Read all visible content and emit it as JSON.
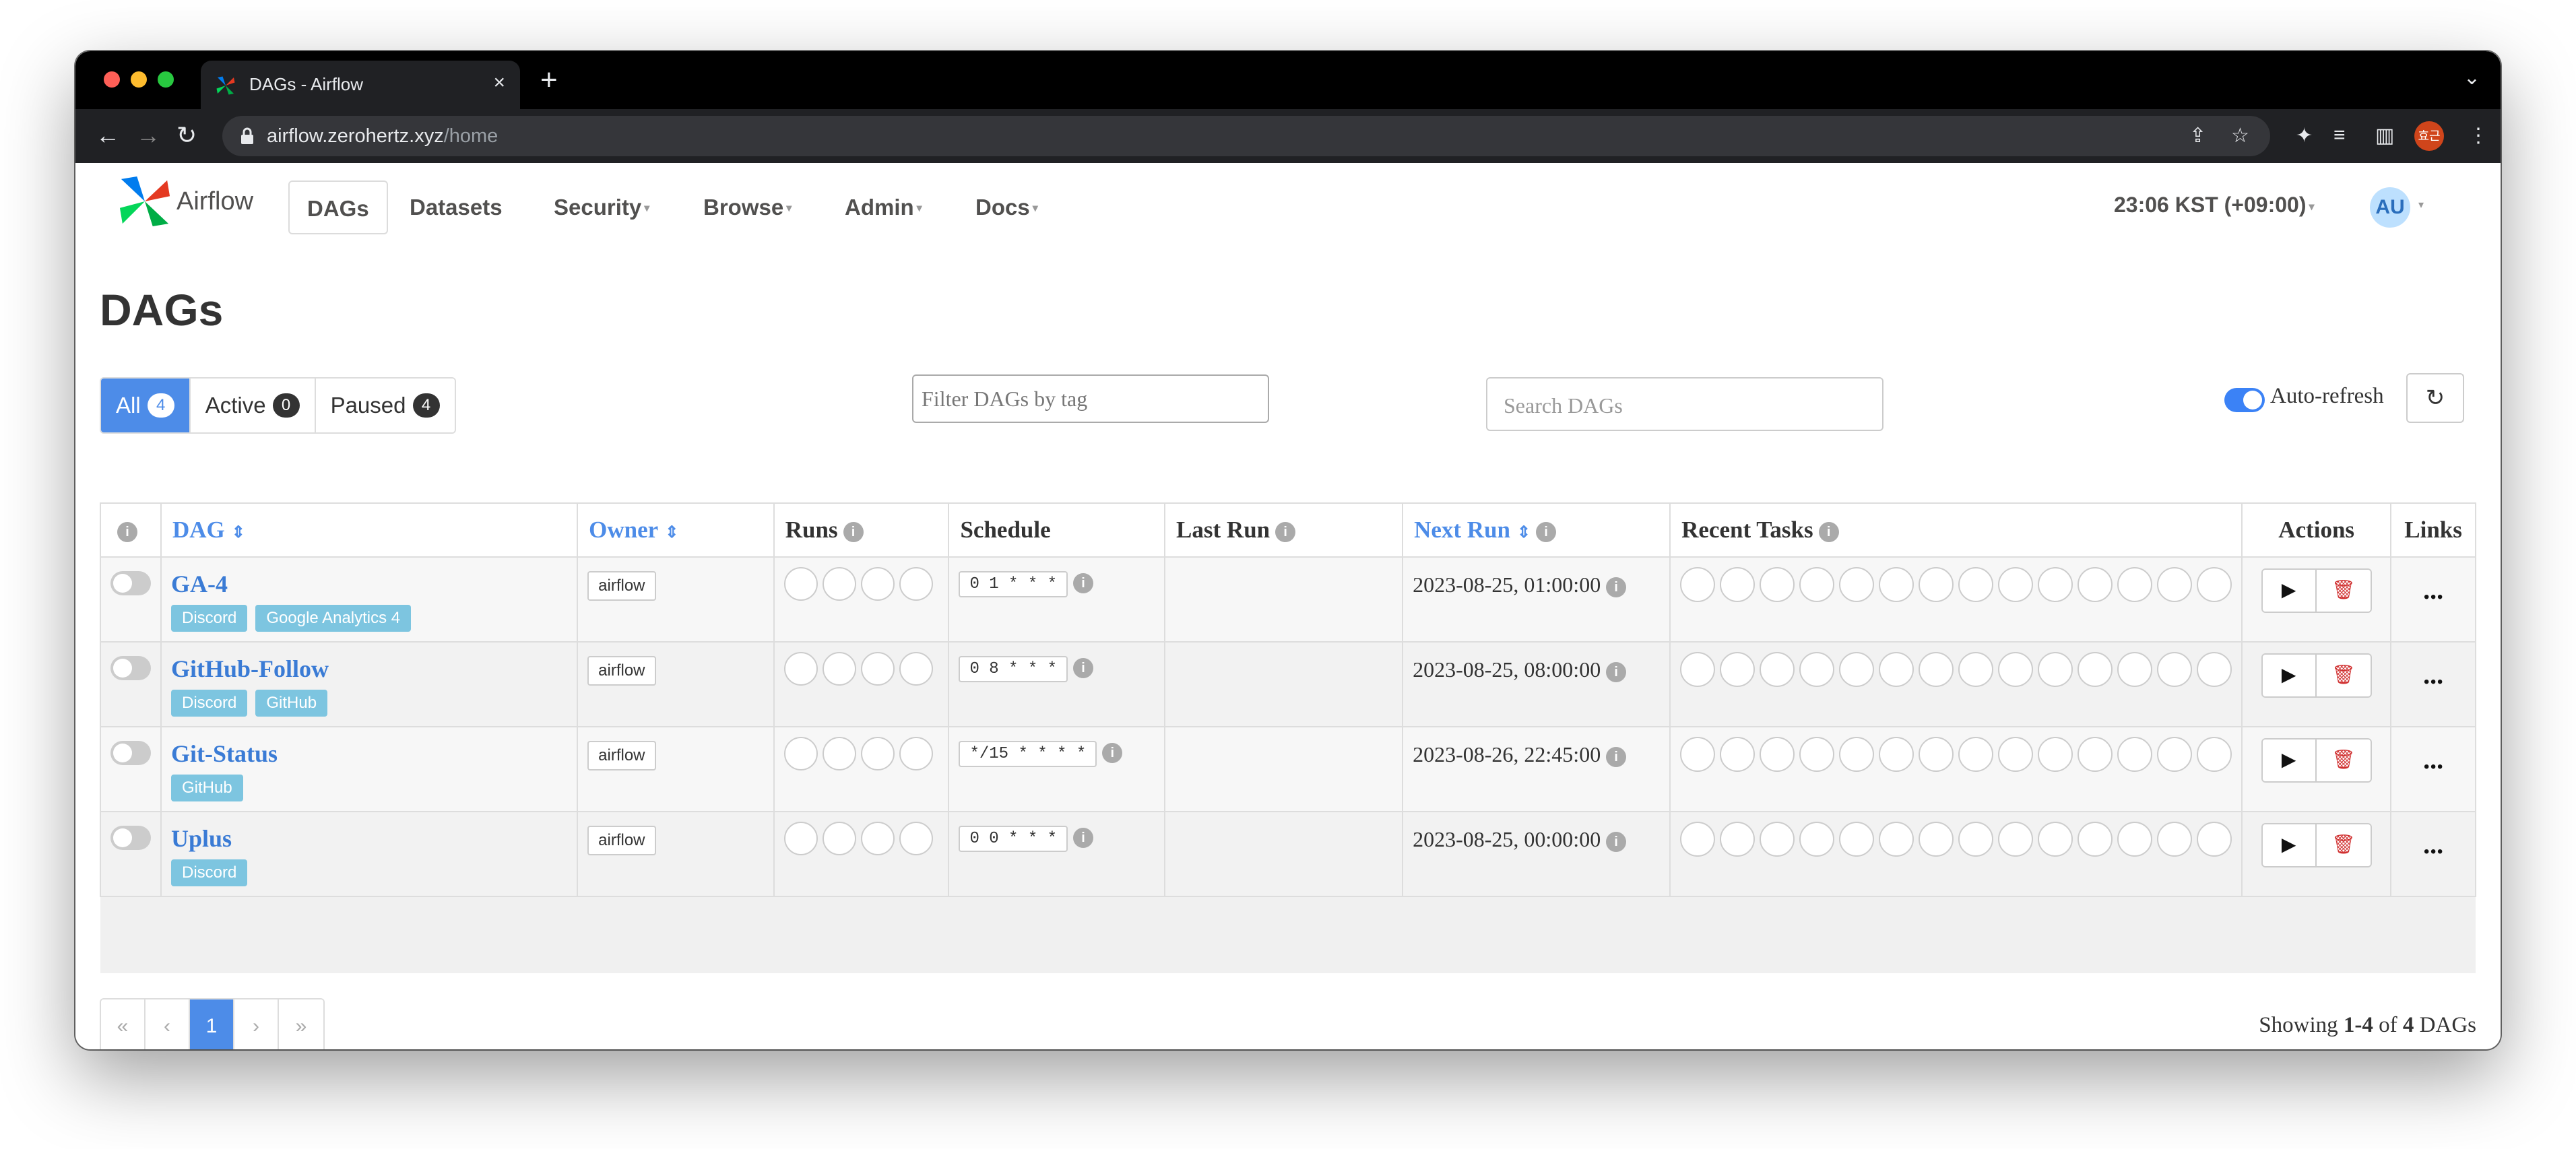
{
  "browser": {
    "tab_title": "DAGs - Airflow",
    "url_host": "airflow.zerohertz.xyz",
    "url_path": "/home",
    "profile_initials": "효근"
  },
  "colors": {
    "accent": "#4d8ce8",
    "tag": "#7dc5e0",
    "delete": "#d03030"
  },
  "nav": {
    "brand": "Airflow",
    "items": [
      {
        "label": "DAGs",
        "has_caret": false
      },
      {
        "label": "Datasets",
        "has_caret": false
      },
      {
        "label": "Security",
        "has_caret": true
      },
      {
        "label": "Browse",
        "has_caret": true
      },
      {
        "label": "Admin",
        "has_caret": true
      },
      {
        "label": "Docs",
        "has_caret": true
      }
    ],
    "clock": "23:06 KST (+09:00)",
    "avatar": "AU"
  },
  "page": {
    "title": "DAGs",
    "status_filters": [
      {
        "label": "All",
        "count": "4"
      },
      {
        "label": "Active",
        "count": "0"
      },
      {
        "label": "Paused",
        "count": "4"
      }
    ],
    "tag_filter_placeholder": "Filter DAGs by tag",
    "search_placeholder": "Search DAGs",
    "auto_refresh_label": "Auto-refresh",
    "auto_refresh_on": true
  },
  "table": {
    "headers": {
      "dag": "DAG",
      "owner": "Owner",
      "runs": "Runs",
      "schedule": "Schedule",
      "last_run": "Last Run",
      "next_run": "Next Run",
      "recent_tasks": "Recent Tasks",
      "actions": "Actions",
      "links": "Links"
    },
    "rows": [
      {
        "name": "GA-4",
        "tags": [
          "Discord",
          "Google Analytics 4"
        ],
        "owner": "airflow",
        "schedule": "0 1 * * *",
        "last_run": "",
        "next_run": "2023-08-25, 01:00:00"
      },
      {
        "name": "GitHub-Follow",
        "tags": [
          "Discord",
          "GitHub"
        ],
        "owner": "airflow",
        "schedule": "0 8 * * *",
        "last_run": "",
        "next_run": "2023-08-25, 08:00:00"
      },
      {
        "name": "Git-Status",
        "tags": [
          "GitHub"
        ],
        "owner": "airflow",
        "schedule": "*/15 * * * *",
        "last_run": "",
        "next_run": "2023-08-26, 22:45:00"
      },
      {
        "name": "Uplus",
        "tags": [
          "Discord"
        ],
        "owner": "airflow",
        "schedule": "0 0 * * *",
        "last_run": "",
        "next_run": "2023-08-25, 00:00:00"
      }
    ],
    "links_label": "..."
  },
  "pagination": {
    "first": "«",
    "prev": "‹",
    "current": "1",
    "next": "›",
    "last": "»"
  },
  "footer": {
    "showing_prefix": "Showing",
    "range": "1-4",
    "of_word": "of",
    "total": "4",
    "suffix": "DAGs"
  }
}
